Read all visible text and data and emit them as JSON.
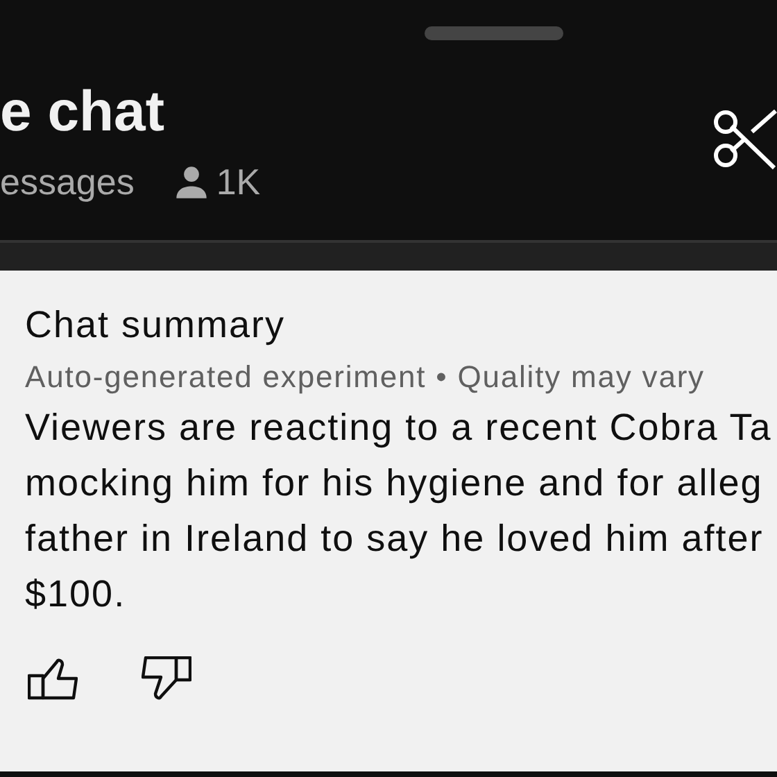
{
  "header": {
    "title": "e chat",
    "messages_label": "essages",
    "viewers": "1K"
  },
  "summary": {
    "title": "Chat summary",
    "subtitle": "Auto-generated experiment • Quality may vary",
    "lines": [
      "Viewers are reacting to a recent Cobra Ta",
      "mocking him for his hygiene and for alleg",
      "father in Ireland to say he loved him after",
      "$100."
    ]
  }
}
